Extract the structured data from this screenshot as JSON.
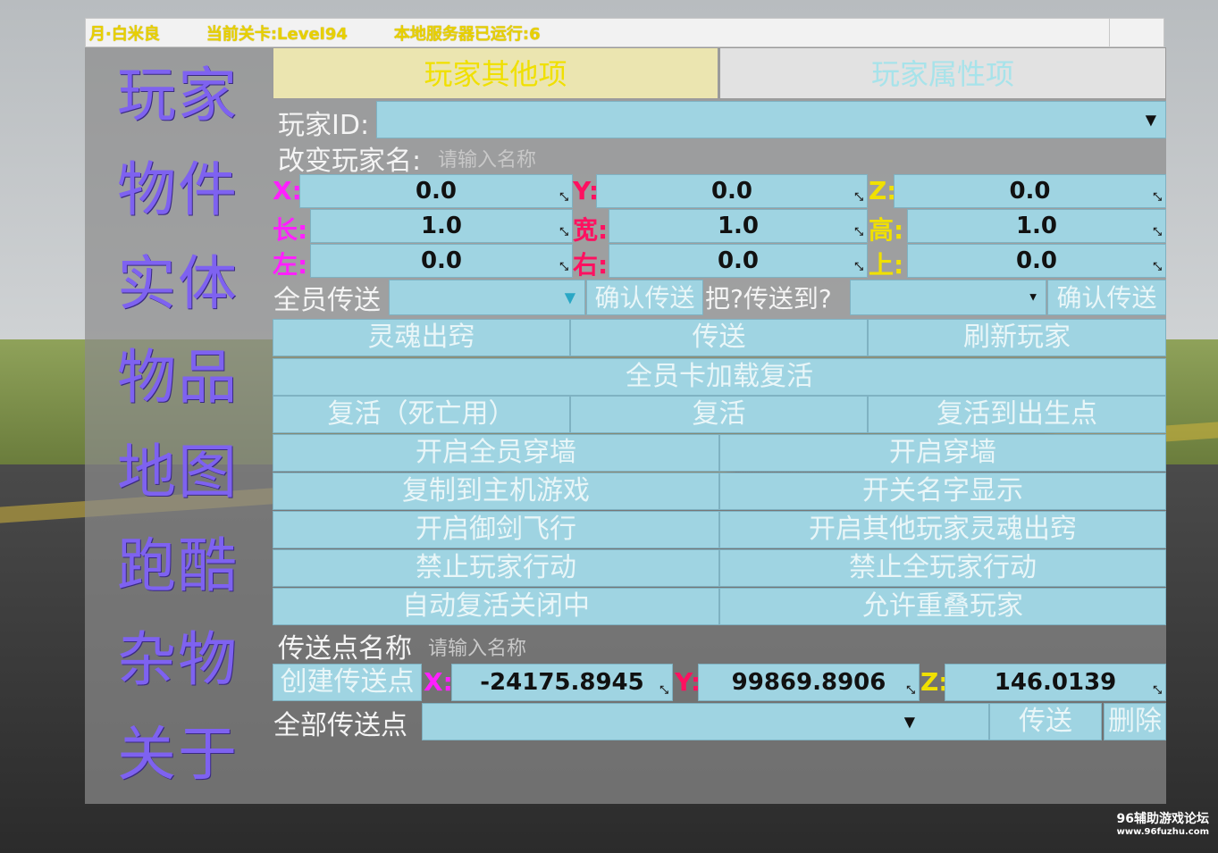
{
  "topbar": {
    "player": "月·白米良",
    "level": "当前关卡:Level94",
    "server": "本地服务器已运行:6"
  },
  "nav": [
    "玩家",
    "物件",
    "实体",
    "物品",
    "地图",
    "跑酷",
    "杂物",
    "关于"
  ],
  "tabs": {
    "active": "玩家其他项",
    "inactive": "玩家属性项"
  },
  "player_id": {
    "label": "玩家ID:"
  },
  "rename": {
    "label": "改变玩家名:",
    "placeholder": "请输入名称"
  },
  "position": {
    "x_label": "X:",
    "y_label": "Y:",
    "z_label": "Z:",
    "x": "0.0",
    "y": "0.0",
    "z": "0.0"
  },
  "scale": {
    "l_label": "长:",
    "w_label": "宽:",
    "h_label": "高:",
    "l": "1.0",
    "w": "1.0",
    "h": "1.0"
  },
  "offset": {
    "left_label": "左:",
    "right_label": "右:",
    "up_label": "上:",
    "left": "0.0",
    "right": "0.0",
    "up": "0.0"
  },
  "teleport_all": {
    "label": "全员传送",
    "confirm1": "确认传送",
    "mid_label": "把?传送到?",
    "confirm2": "确认传送"
  },
  "buttons": {
    "soul": "灵魂出窍",
    "teleport": "传送",
    "refresh": "刷新玩家",
    "all_revive": "全员卡加载复活",
    "revive_dead": "复活（死亡用）",
    "revive": "复活",
    "revive_spawn": "复活到出生点",
    "all_noclip": "开启全员穿墙",
    "noclip": "开启穿墙",
    "copy_host": "复制到主机游戏",
    "toggle_names": "开关名字显示",
    "sword_fly": "开启御剑飞行",
    "others_soul": "开启其他玩家灵魂出窍",
    "ban_player": "禁止玩家行动",
    "ban_all": "禁止全玩家行动",
    "auto_revive": "自动复活关闭中",
    "allow_overlap": "允许重叠玩家"
  },
  "waypoint": {
    "label": "传送点名称",
    "placeholder": "请输入名称",
    "create": "创建传送点",
    "x_label": "X:",
    "y_label": "Y:",
    "z_label": "Z:",
    "x": "-24175.8945",
    "y": "99869.8906",
    "z": "146.0139",
    "all_label": "全部传送点",
    "go": "传送",
    "delete": "删除"
  },
  "watermark": {
    "line1": "96辅助游戏论坛",
    "line2": "www.96fuzhu.com"
  },
  "colors": {
    "accent_purple": "#7e62f0",
    "field_blue": "#9fd4e2",
    "label_magenta": "#ff20ff",
    "label_red": "#ff1060",
    "label_yellow": "#f0e000"
  }
}
